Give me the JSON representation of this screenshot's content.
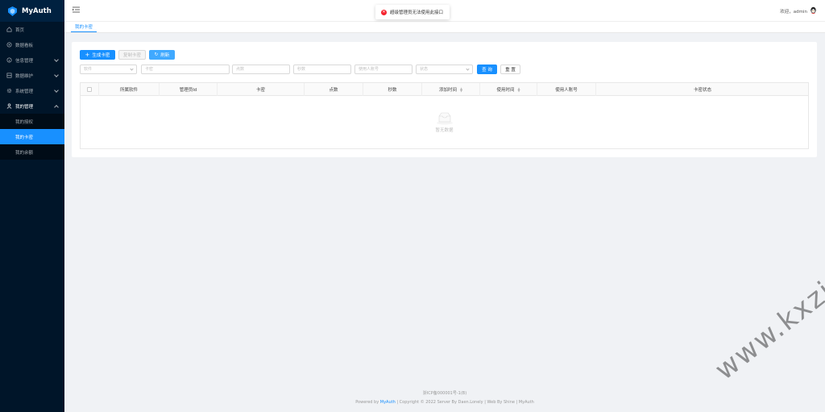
{
  "app": {
    "name": "MyAuth"
  },
  "sidebar": {
    "items": [
      {
        "label": "首页",
        "icon": "home-icon"
      },
      {
        "label": "数据看板",
        "icon": "dashboard-icon"
      },
      {
        "label": "信息管理",
        "icon": "info-icon"
      },
      {
        "label": "数据维护",
        "icon": "database-icon"
      },
      {
        "label": "系统管理",
        "icon": "settings-icon"
      },
      {
        "label": "我的管理",
        "icon": "user-icon"
      }
    ],
    "subitems": [
      {
        "label": "我的授权"
      },
      {
        "label": "我的卡密",
        "active": true
      },
      {
        "label": "我的余额"
      }
    ]
  },
  "header": {
    "welcome": "欢迎，admin"
  },
  "toast": {
    "message": "超级管理员无法使用此接口"
  },
  "tabs": [
    {
      "label": "我的卡密"
    }
  ],
  "toolbar": {
    "generate": "生成卡密",
    "copy": "复制卡密",
    "refresh": "刷新"
  },
  "filters": {
    "software": "软件",
    "card": "卡密",
    "points": "点数",
    "seconds": "秒数",
    "user_account": "使用人账号",
    "status": "状态",
    "query": "查 询",
    "reset": "重 置"
  },
  "table": {
    "columns": [
      "所属软件",
      "管理员Id",
      "卡密",
      "点数",
      "秒数",
      "添加时间",
      "使用时间",
      "使用人账号",
      "卡密状态"
    ],
    "empty_text": "暂无数据"
  },
  "footer": {
    "icp": "浙ICP备000001号-1(B)",
    "powered_prefix": "Powered by ",
    "powered_link": "MyAuth",
    "rest": " | Copyright © 2022 Server By Daen.Lonely | Web By Shine | MyAuth"
  },
  "watermark": {
    "text": "www.kxzi.cn"
  },
  "colors": {
    "sidebar_bg": "#001529",
    "primary": "#1890ff",
    "danger": "#f5222d"
  }
}
